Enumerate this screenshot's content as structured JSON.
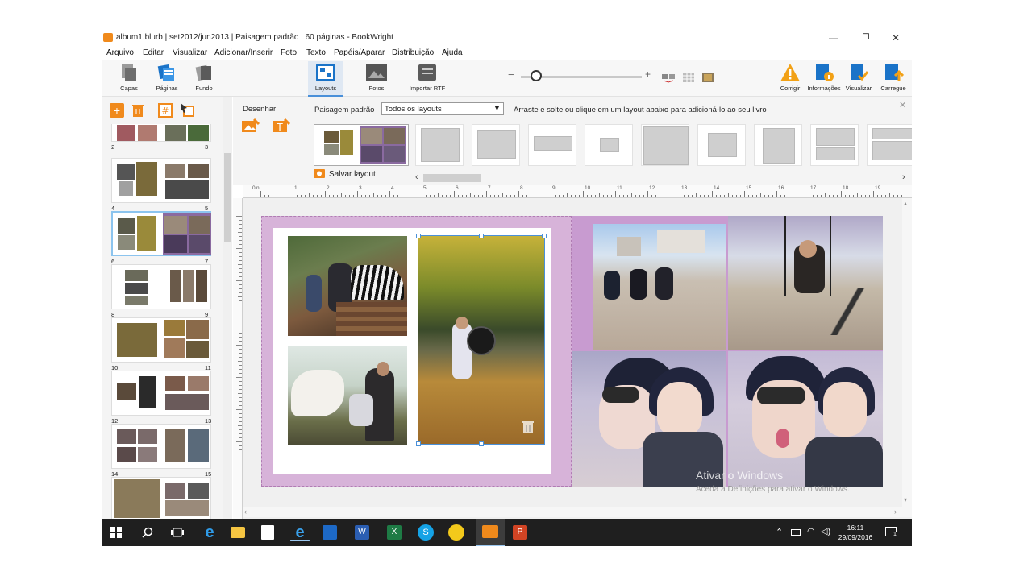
{
  "window": {
    "title": "album1.blurb | set2012/jun2013 | Paisagem padrão | 60 páginas - BookWright",
    "minimize": "—",
    "maximize": "❐",
    "close": "✕"
  },
  "menu": [
    "Arquivo",
    "Editar",
    "Visualizar",
    "Adicionar/Inserir",
    "Foto",
    "Texto",
    "Papéis/Aparar",
    "Distribuição",
    "Ajuda"
  ],
  "toolbar": {
    "left_tools": [
      "Capas",
      "Páginas",
      "Fundo"
    ],
    "center_tools": [
      "Layouts",
      "Fotos",
      "Importar RTF"
    ],
    "right_tools": [
      "Corrigir",
      "Informações",
      "Visualizar",
      "Carregue"
    ],
    "zoom_minus": "−",
    "zoom_plus": "+",
    "zoom_level": 0.08
  },
  "layout_panel": {
    "desenhar_label": "Desenhar",
    "scope_label": "Paisagem padrão",
    "filter_value": "Todos os layouts",
    "hint": "Arraste e solte ou clique em um layout abaixo para adicioná-lo ao seu livro",
    "save_layout": "Salvar layout",
    "close": "✕",
    "scroll_left": "‹",
    "scroll_right": "›"
  },
  "ruler": {
    "origin": "0in",
    "marks": [
      "1",
      "2",
      "3",
      "4",
      "5",
      "6",
      "7",
      "8",
      "9",
      "10",
      "11",
      "12",
      "13",
      "14",
      "15",
      "16",
      "17",
      "18",
      "19"
    ]
  },
  "page_numbers": [
    {
      "left": "2",
      "right": "3"
    },
    {
      "left": "4",
      "right": "5"
    },
    {
      "left": "6",
      "right": "7"
    },
    {
      "left": "8",
      "right": "9"
    },
    {
      "left": "10",
      "right": "11"
    },
    {
      "left": "12",
      "right": "13"
    },
    {
      "left": "14",
      "right": "15"
    }
  ],
  "watermark": {
    "line1": "Ativar o Windows",
    "line2": "Aceda a Definições para ativar o Windows."
  },
  "taskbar": {
    "time": "16:11",
    "date": "29/09/2016",
    "notification_count": "1"
  },
  "colors": {
    "accent_orange": "#f08a1c",
    "accent_blue": "#1a73c8",
    "page_purple": "#d7b3d9"
  }
}
